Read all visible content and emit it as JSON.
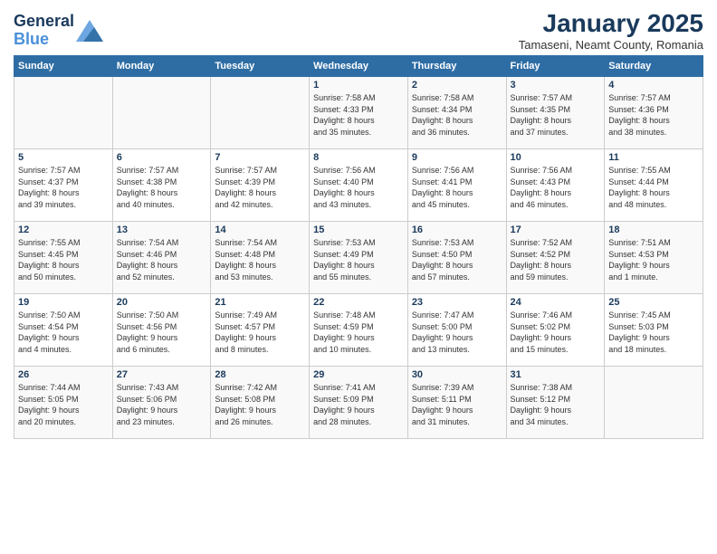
{
  "header": {
    "logo_line1": "General",
    "logo_line2": "Blue",
    "month": "January 2025",
    "location": "Tamaseni, Neamt County, Romania"
  },
  "weekdays": [
    "Sunday",
    "Monday",
    "Tuesday",
    "Wednesday",
    "Thursday",
    "Friday",
    "Saturday"
  ],
  "weeks": [
    [
      {
        "day": "",
        "text": ""
      },
      {
        "day": "",
        "text": ""
      },
      {
        "day": "",
        "text": ""
      },
      {
        "day": "1",
        "text": "Sunrise: 7:58 AM\nSunset: 4:33 PM\nDaylight: 8 hours\nand 35 minutes."
      },
      {
        "day": "2",
        "text": "Sunrise: 7:58 AM\nSunset: 4:34 PM\nDaylight: 8 hours\nand 36 minutes."
      },
      {
        "day": "3",
        "text": "Sunrise: 7:57 AM\nSunset: 4:35 PM\nDaylight: 8 hours\nand 37 minutes."
      },
      {
        "day": "4",
        "text": "Sunrise: 7:57 AM\nSunset: 4:36 PM\nDaylight: 8 hours\nand 38 minutes."
      }
    ],
    [
      {
        "day": "5",
        "text": "Sunrise: 7:57 AM\nSunset: 4:37 PM\nDaylight: 8 hours\nand 39 minutes."
      },
      {
        "day": "6",
        "text": "Sunrise: 7:57 AM\nSunset: 4:38 PM\nDaylight: 8 hours\nand 40 minutes."
      },
      {
        "day": "7",
        "text": "Sunrise: 7:57 AM\nSunset: 4:39 PM\nDaylight: 8 hours\nand 42 minutes."
      },
      {
        "day": "8",
        "text": "Sunrise: 7:56 AM\nSunset: 4:40 PM\nDaylight: 8 hours\nand 43 minutes."
      },
      {
        "day": "9",
        "text": "Sunrise: 7:56 AM\nSunset: 4:41 PM\nDaylight: 8 hours\nand 45 minutes."
      },
      {
        "day": "10",
        "text": "Sunrise: 7:56 AM\nSunset: 4:43 PM\nDaylight: 8 hours\nand 46 minutes."
      },
      {
        "day": "11",
        "text": "Sunrise: 7:55 AM\nSunset: 4:44 PM\nDaylight: 8 hours\nand 48 minutes."
      }
    ],
    [
      {
        "day": "12",
        "text": "Sunrise: 7:55 AM\nSunset: 4:45 PM\nDaylight: 8 hours\nand 50 minutes."
      },
      {
        "day": "13",
        "text": "Sunrise: 7:54 AM\nSunset: 4:46 PM\nDaylight: 8 hours\nand 52 minutes."
      },
      {
        "day": "14",
        "text": "Sunrise: 7:54 AM\nSunset: 4:48 PM\nDaylight: 8 hours\nand 53 minutes."
      },
      {
        "day": "15",
        "text": "Sunrise: 7:53 AM\nSunset: 4:49 PM\nDaylight: 8 hours\nand 55 minutes."
      },
      {
        "day": "16",
        "text": "Sunrise: 7:53 AM\nSunset: 4:50 PM\nDaylight: 8 hours\nand 57 minutes."
      },
      {
        "day": "17",
        "text": "Sunrise: 7:52 AM\nSunset: 4:52 PM\nDaylight: 8 hours\nand 59 minutes."
      },
      {
        "day": "18",
        "text": "Sunrise: 7:51 AM\nSunset: 4:53 PM\nDaylight: 9 hours\nand 1 minute."
      }
    ],
    [
      {
        "day": "19",
        "text": "Sunrise: 7:50 AM\nSunset: 4:54 PM\nDaylight: 9 hours\nand 4 minutes."
      },
      {
        "day": "20",
        "text": "Sunrise: 7:50 AM\nSunset: 4:56 PM\nDaylight: 9 hours\nand 6 minutes."
      },
      {
        "day": "21",
        "text": "Sunrise: 7:49 AM\nSunset: 4:57 PM\nDaylight: 9 hours\nand 8 minutes."
      },
      {
        "day": "22",
        "text": "Sunrise: 7:48 AM\nSunset: 4:59 PM\nDaylight: 9 hours\nand 10 minutes."
      },
      {
        "day": "23",
        "text": "Sunrise: 7:47 AM\nSunset: 5:00 PM\nDaylight: 9 hours\nand 13 minutes."
      },
      {
        "day": "24",
        "text": "Sunrise: 7:46 AM\nSunset: 5:02 PM\nDaylight: 9 hours\nand 15 minutes."
      },
      {
        "day": "25",
        "text": "Sunrise: 7:45 AM\nSunset: 5:03 PM\nDaylight: 9 hours\nand 18 minutes."
      }
    ],
    [
      {
        "day": "26",
        "text": "Sunrise: 7:44 AM\nSunset: 5:05 PM\nDaylight: 9 hours\nand 20 minutes."
      },
      {
        "day": "27",
        "text": "Sunrise: 7:43 AM\nSunset: 5:06 PM\nDaylight: 9 hours\nand 23 minutes."
      },
      {
        "day": "28",
        "text": "Sunrise: 7:42 AM\nSunset: 5:08 PM\nDaylight: 9 hours\nand 26 minutes."
      },
      {
        "day": "29",
        "text": "Sunrise: 7:41 AM\nSunset: 5:09 PM\nDaylight: 9 hours\nand 28 minutes."
      },
      {
        "day": "30",
        "text": "Sunrise: 7:39 AM\nSunset: 5:11 PM\nDaylight: 9 hours\nand 31 minutes."
      },
      {
        "day": "31",
        "text": "Sunrise: 7:38 AM\nSunset: 5:12 PM\nDaylight: 9 hours\nand 34 minutes."
      },
      {
        "day": "",
        "text": ""
      }
    ]
  ]
}
